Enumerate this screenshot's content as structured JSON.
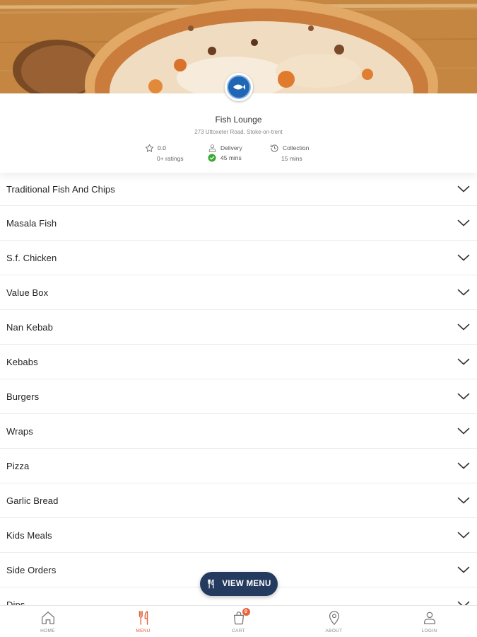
{
  "restaurant": {
    "name": "Fish Lounge",
    "address": "273 Uttoxeter Road, Stoke-on-trent"
  },
  "stats": {
    "rating_value": "0.0",
    "rating_count": "0+ ratings",
    "delivery_label": "Delivery",
    "delivery_time": "45 mins",
    "collection_label": "Collection",
    "collection_time": "15 mins"
  },
  "menu": {
    "categories": [
      "Traditional Fish And Chips",
      "Masala Fish",
      "S.f. Chicken",
      "Value Box",
      "Nan Kebab",
      "Kebabs",
      "Burgers",
      "Wraps",
      "Pizza",
      "Garlic Bread",
      "Kids Meals",
      "Side Orders",
      "Dips"
    ]
  },
  "view_menu": {
    "label": "VIEW MENU",
    "icon": "cutlery-icon"
  },
  "nav": {
    "items": [
      {
        "label": "HOME",
        "icon": "home-icon"
      },
      {
        "label": "MENU",
        "icon": "cutlery-icon"
      },
      {
        "label": "CART",
        "icon": "cart-icon",
        "badge": "0"
      },
      {
        "label": "ABOUT",
        "icon": "location-pin-icon"
      },
      {
        "label": "LOGIN",
        "icon": "user-icon"
      }
    ],
    "active": "MENU"
  },
  "colors": {
    "accent": "#e0603a",
    "pill": "#243a5e",
    "check": "#3aaa35"
  }
}
